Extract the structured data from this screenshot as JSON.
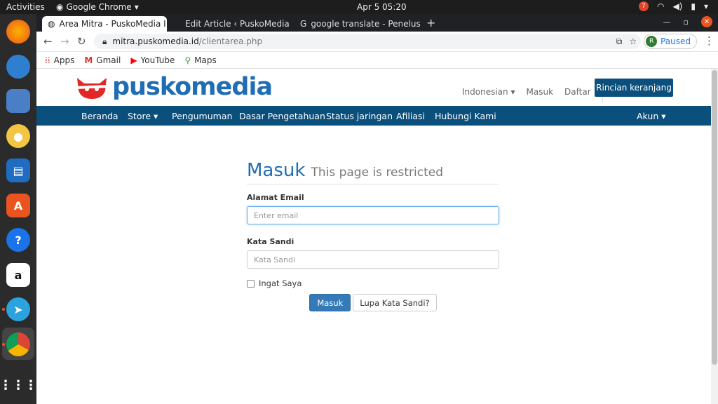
{
  "system": {
    "activities": "Activities",
    "app_name": "Google Chrome",
    "clock": "Apr 5  05:20",
    "notif_count": "7"
  },
  "tabs": [
    {
      "title": "Area Mitra - PuskoMedia I"
    },
    {
      "title": "Edit Article ‹ PuskoMedia"
    },
    {
      "title": "google translate - Penelus"
    }
  ],
  "toolbar": {
    "url_domain": "mitra.puskomedia.id",
    "url_path": "/clientarea.php",
    "profile_initial": "R",
    "profile_status": "Paused"
  },
  "bookmarks": [
    "Apps",
    "Gmail",
    "YouTube",
    "Maps"
  ],
  "site": {
    "logo_text": "puskomedia",
    "language": "Indonesian",
    "login_link": "Masuk",
    "register_link": "Daftar",
    "cart_button": "Rincian keranjang",
    "nav": [
      "Beranda",
      "Store",
      "Pengumuman",
      "Dasar Pengetahuan",
      "Status jaringan",
      "Afiliasi",
      "Hubungi Kami"
    ],
    "account": "Akun"
  },
  "login": {
    "title": "Masuk",
    "subtitle": "This page is restricted",
    "email_label": "Alamat Email",
    "email_placeholder": "Enter email",
    "password_label": "Kata Sandi",
    "password_placeholder": "Kata Sandi",
    "remember_label": "Ingat Saya",
    "submit": "Masuk",
    "forgot": "Lupa Kata Sandi?"
  },
  "colors": {
    "brand_blue": "#0b4f7c",
    "logo_red": "#e32626",
    "primary_button": "#337ab7"
  }
}
